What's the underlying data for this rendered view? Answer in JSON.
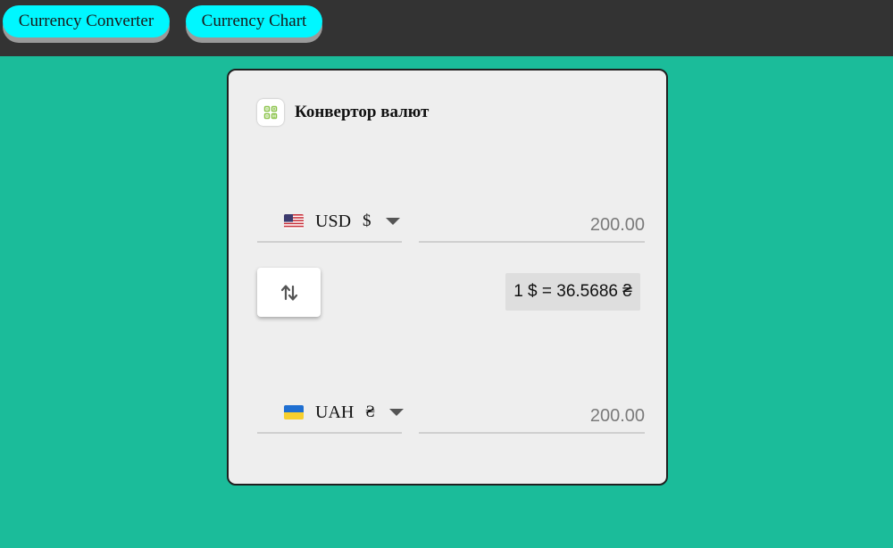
{
  "nav": {
    "converter_label": "Currency Converter",
    "chart_label": "Currency Chart"
  },
  "card": {
    "icon": "calculator-icon",
    "title": "Конвертор валют"
  },
  "from": {
    "flag": "us-flag-icon",
    "code": "USD",
    "symbol": "$",
    "amount": "200.00"
  },
  "to": {
    "flag": "ua-flag-icon",
    "code": "UAH",
    "symbol": "₴",
    "amount": "200.00"
  },
  "swap": {
    "icon": "swap-vertical-icon"
  },
  "rate": {
    "text": "1 $ = 36.5686 ₴"
  },
  "colors": {
    "page_background": "#1bbc9a",
    "topbar": "#333333",
    "nav_button": "#00f7ff",
    "card_background": "#eeeeee",
    "icon_accent": "#8bc34a"
  }
}
